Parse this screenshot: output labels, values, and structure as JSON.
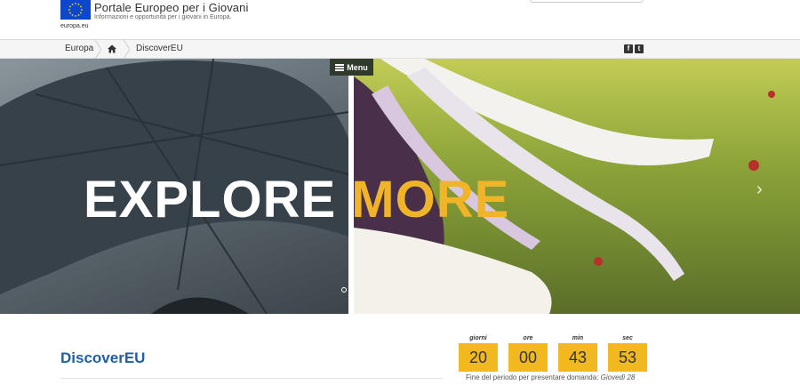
{
  "header": {
    "title": "Portale Europeo per i Giovani",
    "subtitle": "Informazioni e opportunità per i giovani in Europa.",
    "logo_caption": "europa.eu",
    "logo_color": "#0e47cb"
  },
  "breadcrumb": {
    "items": [
      "Europa",
      "DiscoverEU"
    ],
    "home_icon": "home-icon",
    "social": {
      "facebook": "f",
      "twitter": "t"
    }
  },
  "hero": {
    "menu_label": "Menu",
    "headline_word_1": "EXPLORE",
    "headline_word_2": "MORE",
    "next_arrow": "›",
    "accent": "#f0b429"
  },
  "main": {
    "title": "DiscoverEU"
  },
  "countdown": {
    "units": [
      {
        "label": "giorni",
        "value": "20"
      },
      {
        "label": "ore",
        "value": "00"
      },
      {
        "label": "min",
        "value": "43"
      },
      {
        "label": "sec",
        "value": "53"
      }
    ],
    "deadline_text": "Fine del periodo per presentare domanda:",
    "deadline_date": "Giovedì 28",
    "box_color": "#f2b81f"
  }
}
